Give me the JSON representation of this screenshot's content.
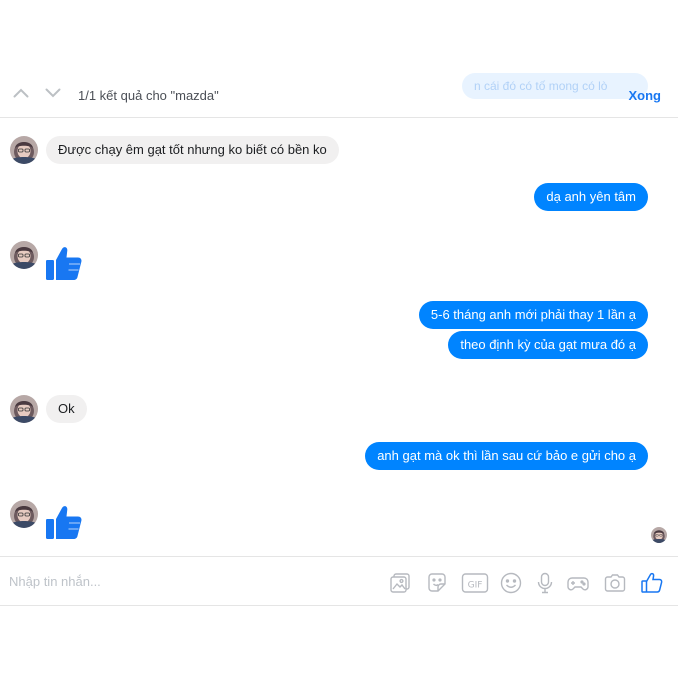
{
  "search": {
    "result_text": "1/1 kết quả cho \"mazda\"",
    "faded_message": "n cái đó có tố mong có lò",
    "done_label": "Xong"
  },
  "messages": [
    {
      "side": "in",
      "type": "text",
      "text": "Được chạy êm gạt tốt nhưng ko biết có bền ko"
    },
    {
      "side": "out",
      "type": "text",
      "text": "dạ anh yên tâm"
    },
    {
      "side": "in",
      "type": "like"
    },
    {
      "side": "out",
      "type": "text",
      "text": "5-6 tháng anh mới phải thay 1 lần ạ"
    },
    {
      "side": "out",
      "type": "text",
      "text": "theo định kỳ của gạt mưa đó ạ"
    },
    {
      "side": "in",
      "type": "text",
      "text": "Ok"
    },
    {
      "side": "out",
      "type": "text",
      "text": "anh gạt mà ok thì lần sau cứ bảo e gửi cho ạ"
    },
    {
      "side": "in",
      "type": "like"
    }
  ],
  "composer": {
    "placeholder": "Nhập tin nhắn...",
    "tools": [
      "image-icon",
      "sticker-icon",
      "gif-icon",
      "emoji-icon",
      "microphone-icon",
      "game-controller-icon",
      "camera-icon",
      "like-icon"
    ]
  },
  "colors": {
    "accent": "#0084ff",
    "incoming_bubble": "#f1f0f0",
    "icon_gray": "#b6b9bf",
    "like_blue": "#1877f2"
  }
}
